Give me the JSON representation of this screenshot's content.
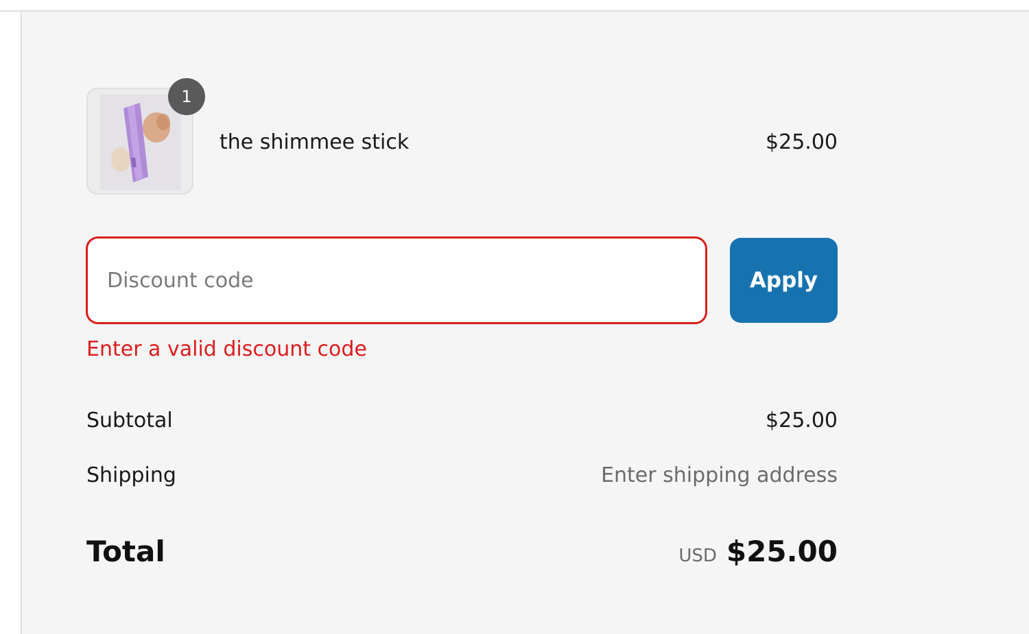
{
  "product": {
    "name": "the shimmee stick",
    "price": "$25.00",
    "quantity": "1",
    "thumbnail_icon": "product-thumbnail"
  },
  "discount": {
    "placeholder": "Discount code",
    "value": "",
    "apply_label": "Apply",
    "error": "Enter a valid discount code"
  },
  "summary": {
    "subtotal_label": "Subtotal",
    "subtotal_value": "$25.00",
    "shipping_label": "Shipping",
    "shipping_value": "Enter shipping address",
    "total_label": "Total",
    "currency": "USD",
    "total_value": "$25.00"
  },
  "colors": {
    "accent": "#1773b0",
    "error": "#dd1d1d",
    "panel_bg": "#f5f5f5"
  }
}
